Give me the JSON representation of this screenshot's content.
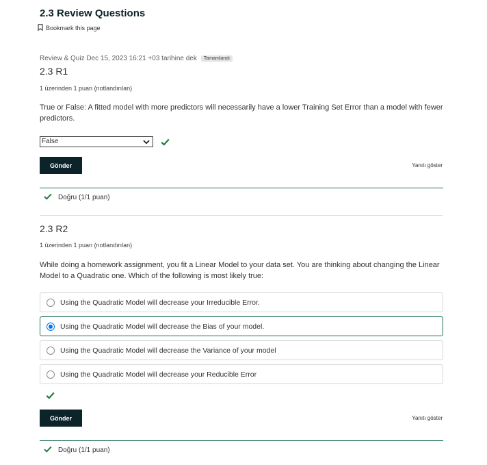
{
  "page": {
    "title": "2.3 Review Questions",
    "bookmark_label": "Bookmark this page",
    "meta_text": "Review & Quiz Dec 15, 2023 16:21 +03 tarihine dek",
    "status_badge": "Tamamlandı"
  },
  "colors": {
    "accent": "#0b2329",
    "success": "#1a6b5a",
    "radio": "#0075e1"
  },
  "questions": [
    {
      "title": "2.3 R1",
      "points": "1 üzerinden 1 puan (notlandırılan)",
      "prompt": "True or False: A fitted model with more predictors will necessarily have a lower Training Set Error than a model with fewer predictors.",
      "select_value": "False",
      "submit_label": "Gönder",
      "show_answer_label": "Yanıtı göster",
      "feedback": "Doğru (1/1 puan)"
    },
    {
      "title": "2.3 R2",
      "points": "1 üzerinden 1 puan (notlandırılan)",
      "prompt": "While doing a homework assignment, you fit a Linear Model to your data set. You are thinking about changing the Linear Model to a Quadratic one. Which of the following is most likely true:",
      "options": [
        "Using the Quadratic Model will decrease your Irreducible Error.",
        "Using the Quadratic Model will decrease the Bias of your model.",
        "Using the Quadratic Model will decrease the Variance of your model",
        "Using the Quadratic Model will decrease your Reducible Error"
      ],
      "selected_option": 1,
      "submit_label": "Gönder",
      "show_answer_label": "Yanıtı göster",
      "feedback": "Doğru (1/1 puan)"
    }
  ]
}
